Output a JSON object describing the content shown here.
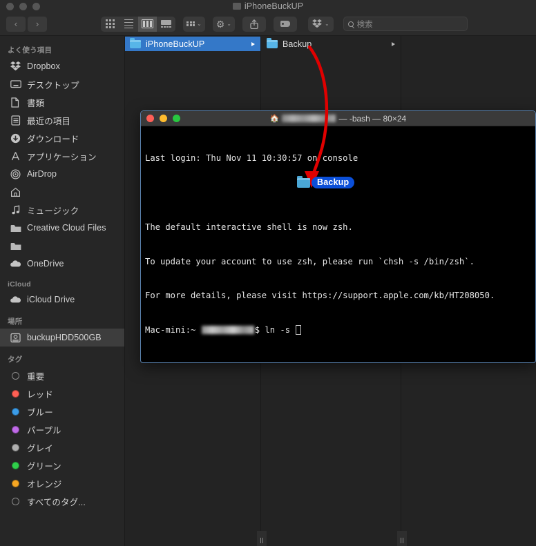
{
  "window": {
    "title": "iPhoneBuckUP",
    "title_icon": "folder-icon"
  },
  "toolbar": {
    "back_label": "‹",
    "forward_label": "›",
    "view_icon_label": "icon-view",
    "view_list_label": "list-view",
    "view_column_label": "column-view",
    "view_gallery_label": "gallery-view",
    "group_label": "group-by",
    "action_label": "action-gear",
    "share_label": "share",
    "tag_label": "tags",
    "dropbox_label": "dropbox",
    "chevron": "⌄"
  },
  "search": {
    "placeholder": "検索"
  },
  "sidebar": {
    "sections": [
      {
        "header": "よく使う項目",
        "items": [
          {
            "label": "Dropbox",
            "icon": "dropbox-icon",
            "selected": false
          },
          {
            "label": "デスクトップ",
            "icon": "desktop-icon",
            "selected": false
          },
          {
            "label": "書類",
            "icon": "documents-icon",
            "selected": false
          },
          {
            "label": "最近の項目",
            "icon": "recents-icon",
            "selected": false
          },
          {
            "label": "ダウンロード",
            "icon": "downloads-icon",
            "selected": false
          },
          {
            "label": "アプリケーション",
            "icon": "applications-icon",
            "selected": false
          },
          {
            "label": "AirDrop",
            "icon": "airdrop-icon",
            "selected": false
          },
          {
            "label": "",
            "icon": "home-icon",
            "selected": false
          },
          {
            "label": "ミュージック",
            "icon": "music-icon",
            "selected": false
          },
          {
            "label": "Creative Cloud Files",
            "icon": "folder-icon",
            "selected": false
          },
          {
            "label": "",
            "icon": "folder-icon",
            "selected": false
          },
          {
            "label": "OneDrive",
            "icon": "cloud-icon",
            "selected": false
          }
        ]
      },
      {
        "header": "iCloud",
        "items": [
          {
            "label": "iCloud Drive",
            "icon": "icloud-icon",
            "selected": false
          }
        ]
      },
      {
        "header": "場所",
        "items": [
          {
            "label": "buckupHDD500GB",
            "icon": "harddisk-icon",
            "selected": true
          }
        ]
      },
      {
        "header": "タグ",
        "items": [
          {
            "label": "重要",
            "icon": "tag-dot",
            "color": "none"
          },
          {
            "label": "レッド",
            "icon": "tag-dot",
            "color": "#ff6054"
          },
          {
            "label": "ブルー",
            "icon": "tag-dot",
            "color": "#3b9ce8"
          },
          {
            "label": "パープル",
            "icon": "tag-dot",
            "color": "#c06ae8"
          },
          {
            "label": "グレイ",
            "icon": "tag-dot",
            "color": "#b0b0b0"
          },
          {
            "label": "グリーン",
            "icon": "tag-dot",
            "color": "#30cf4b"
          },
          {
            "label": "オレンジ",
            "icon": "tag-dot",
            "color": "#f5a623"
          },
          {
            "label": "すべてのタグ...",
            "icon": "tag-dot",
            "color": "none"
          }
        ]
      }
    ]
  },
  "columns": [
    {
      "name": "iPhoneBuckUP",
      "selected": true
    },
    {
      "name": "Backup",
      "selected": false
    }
  ],
  "terminal": {
    "title_suffix": "— -bash — 80×24",
    "title_icon": "home-icon",
    "lines": [
      "Last login: Thu Nov 11 10:30:57 on console",
      "",
      "The default interactive shell is now zsh.",
      "To update your account to use zsh, please run `chsh -s /bin/zsh`.",
      "For more details, please visit https://support.apple.com/kb/HT208050."
    ],
    "prompt_prefix": "Mac-mini:~ ",
    "prompt_command": "$ ln -s "
  },
  "drag": {
    "label": "Backup",
    "chip_color": "#0b4fd8"
  },
  "annotation": {
    "arrow_color": "#e00000"
  }
}
